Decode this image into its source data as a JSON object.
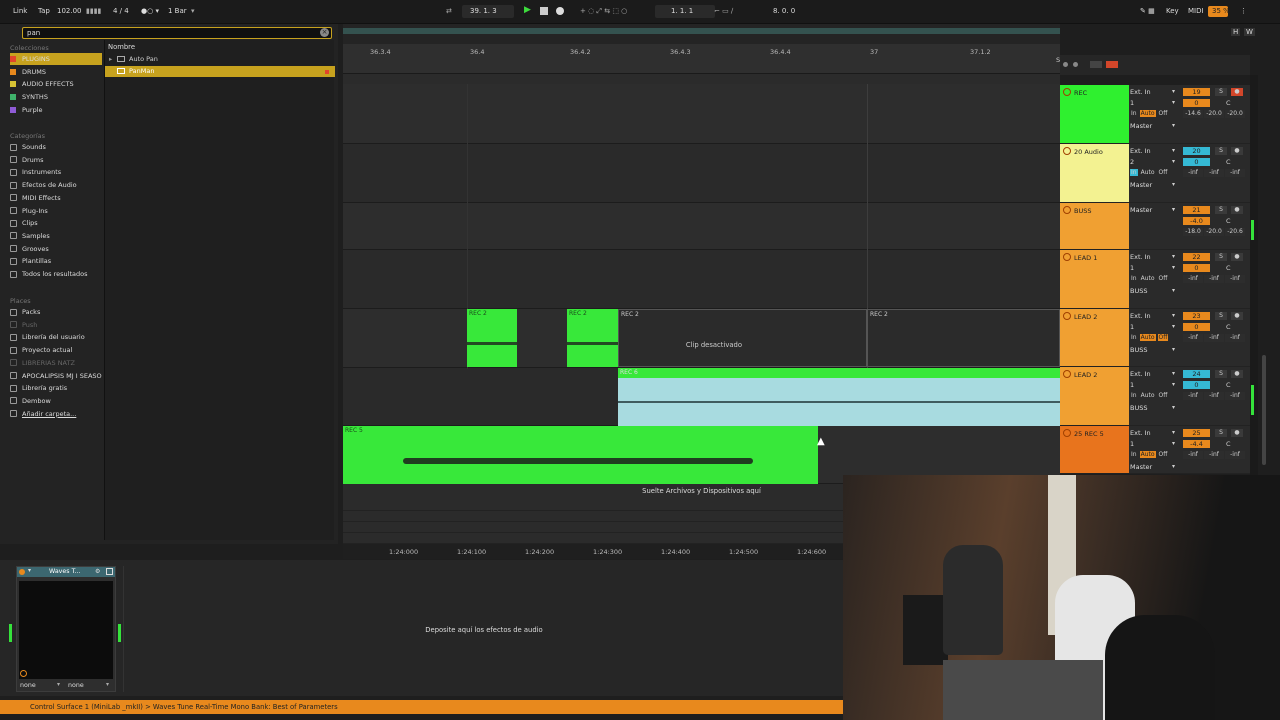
{
  "topbar": {
    "link": "Link",
    "tap": "Tap",
    "tempo": "102.00",
    "meter": "4 / 4",
    "quant": "1 Bar",
    "position": "39.  1.  3",
    "loop_start": "1.  1.  1",
    "loop_len": "8.  0.  0",
    "key": "Key",
    "midi": "MIDI",
    "cpu": "35 %",
    "h": "H",
    "w": "W"
  },
  "browser": {
    "search_value": "pan",
    "collections_label": "Colecciones",
    "collections": [
      {
        "label": "PLUGINS",
        "color": "#e2452b"
      },
      {
        "label": "DRUMS",
        "color": "#e8891d"
      },
      {
        "label": "AUDIO EFFECTS",
        "color": "#d6c234"
      },
      {
        "label": "SYNTHS",
        "color": "#3fb36b"
      },
      {
        "label": "Purple",
        "color": "#8f5bd6"
      }
    ],
    "categories_label": "Categorías",
    "categories": [
      "Sounds",
      "Drums",
      "Instruments",
      "Efectos de Audio",
      "MIDI Effects",
      "Plug-Ins",
      "Clips",
      "Samples",
      "Grooves",
      "Plantillas",
      "Todos los resultados"
    ],
    "places_label": "Places",
    "places": [
      "Packs",
      "Push",
      "Librería del usuario",
      "Proyecto actual",
      "LIBRERIAS NATZ",
      "APOCALIPSIS MJ I SEASO",
      "Librería gratis",
      "Dembow",
      "Añadir carpeta..."
    ],
    "column_header": "Nombre",
    "results": [
      "Auto Pan",
      "PanMan"
    ]
  },
  "ruler": {
    "top_ticks": [
      "36.3.4",
      "36.4",
      "36.4.2",
      "36.4.3",
      "36.4.4",
      "37",
      "37.1.2"
    ],
    "bottom_ticks": [
      "1:24:000",
      "1:24:100",
      "1:24:200",
      "1:24:300",
      "1:24:400",
      "1:24:500",
      "1:24:600"
    ],
    "set_label": "Set"
  },
  "clips": {
    "rec2_a": "REC 2",
    "rec2_b": "REC 2",
    "rec2_c": "REC 2",
    "rec2_d": "REC 2",
    "deactivated": "Clip desactivado",
    "rec6": "REC 6",
    "rec5": "REC 5",
    "drop_hint": "Suelte Archivos y Dispositivos aquí"
  },
  "tracks": [
    {
      "name": "REC",
      "color": "#2ff02f",
      "input": "Ext. In",
      "ch": "1",
      "out": "Master",
      "num": "19",
      "numcolor": "#e8891d",
      "vol": "0",
      "pan": "C",
      "a": "-14.6",
      "b": "-20.0",
      "c": "-20.0"
    },
    {
      "name": "20 Audio",
      "color": "#f3f291",
      "input": "Ext. In",
      "ch": "2",
      "out": "Master",
      "num": "20",
      "numcolor": "#35b9d4",
      "vol": "0",
      "pan": "C",
      "a": "-inf",
      "b": "-inf",
      "c": "-inf"
    },
    {
      "name": "BUSS",
      "color": "#f0a032",
      "input": "Master",
      "ch": "",
      "out": "",
      "num": "21",
      "numcolor": "#e8891d",
      "vol": "-4.0",
      "pan": "C",
      "a": "-18.0",
      "b": "-20.0",
      "c": "-20.6"
    },
    {
      "name": "LEAD 1",
      "color": "#f0a032",
      "input": "Ext. In",
      "ch": "1",
      "out": "BUSS",
      "num": "22",
      "numcolor": "#e8891d",
      "vol": "0",
      "pan": "C",
      "a": "-inf",
      "b": "-inf",
      "c": "-inf"
    },
    {
      "name": "LEAD 2",
      "color": "#f0a032",
      "input": "Ext. In",
      "ch": "1",
      "out": "BUSS",
      "num": "23",
      "numcolor": "#e8891d",
      "vol": "0",
      "pan": "C",
      "a": "-inf",
      "b": "-inf",
      "c": "-inf"
    },
    {
      "name": "LEAD 2",
      "color": "#f0a032",
      "input": "Ext. In",
      "ch": "1",
      "out": "BUSS",
      "num": "24",
      "numcolor": "#35b9d4",
      "vol": "0",
      "pan": "C",
      "a": "-inf",
      "b": "-inf",
      "c": "-inf"
    },
    {
      "name": "25 REC 5",
      "color": "#e8741d",
      "input": "Ext. In",
      "ch": "1",
      "out": "Master",
      "num": "25",
      "numcolor": "#e8891d",
      "vol": "-4.4",
      "pan": "C",
      "a": "-inf",
      "b": "-inf",
      "c": "-inf"
    }
  ],
  "mixer_labels": {
    "in": "In",
    "auto": "Auto",
    "off": "Off",
    "s": "S"
  },
  "device": {
    "plugin_name": "Waves T...",
    "left_select": "none",
    "right_select": "none",
    "drop_hint": "Deposite aquí los efectos de audio"
  },
  "status": "Control Surface 1 (MiniLab _mkII) > Waves Tune Real-Time Mono Bank: Best of Parameters"
}
